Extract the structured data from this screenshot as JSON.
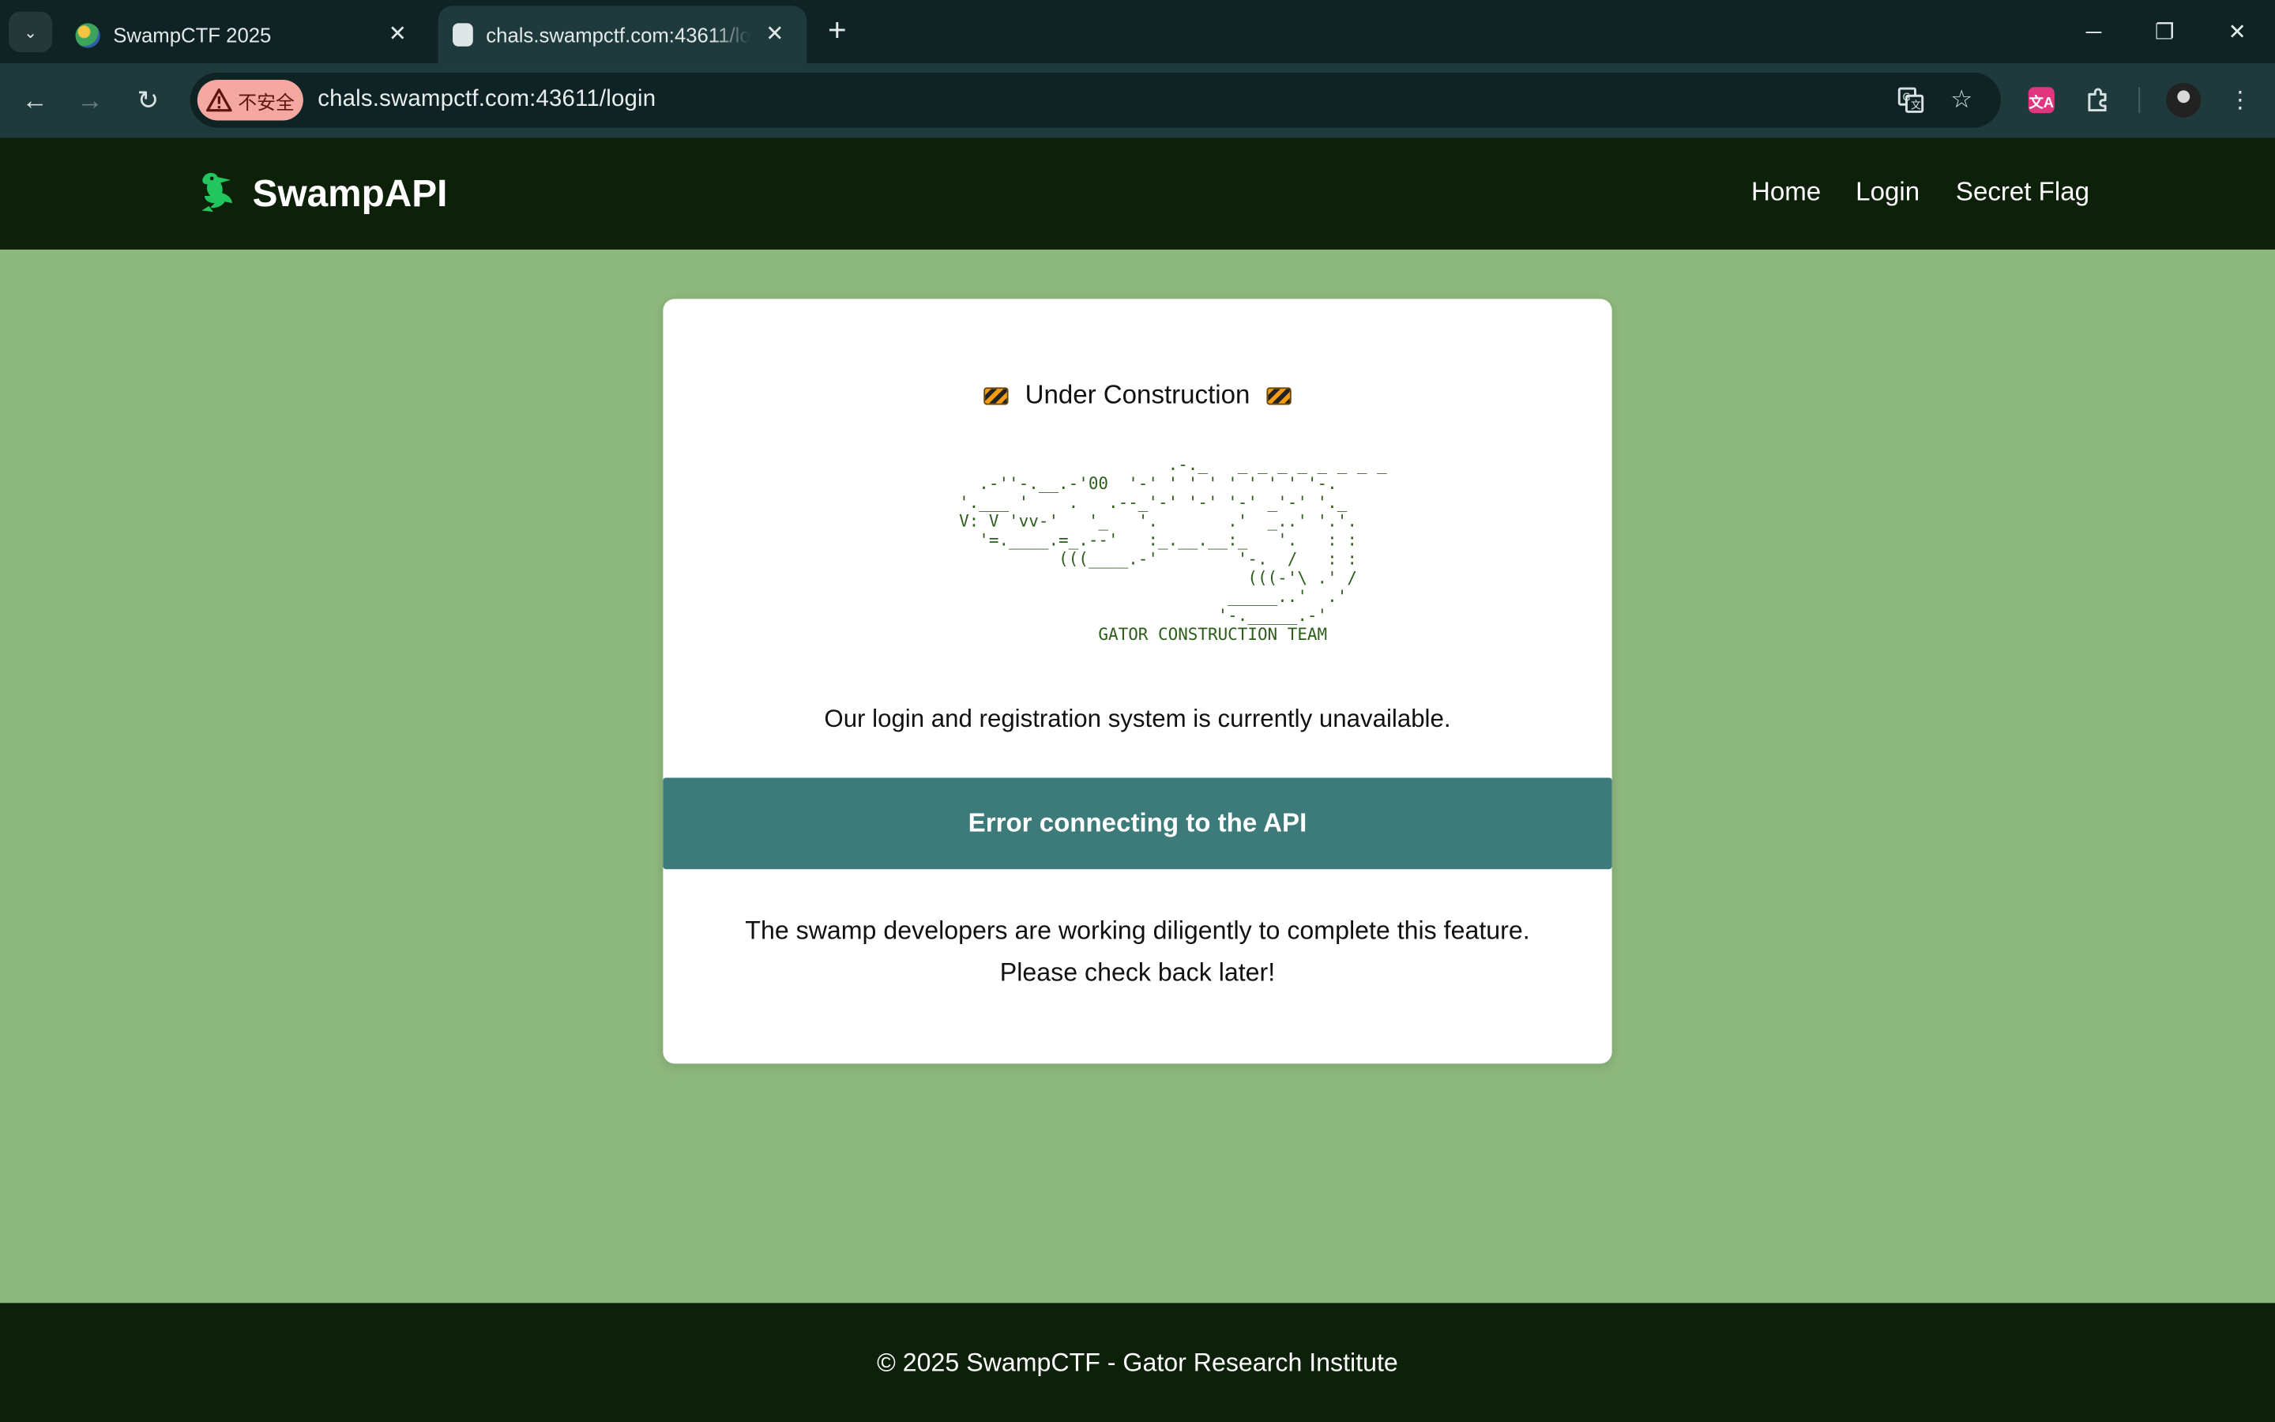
{
  "browser": {
    "tabs": [
      {
        "title": "SwampCTF 2025",
        "active": false
      },
      {
        "title": "chals.swampctf.com:43611/lo",
        "active": true
      }
    ],
    "omnibox": {
      "security_label": "不安全",
      "url": "chals.swampctf.com:43611/login"
    }
  },
  "site": {
    "brand": "SwampAPI",
    "nav": {
      "home": "Home",
      "login": "Login",
      "secret_flag": "Secret Flag"
    }
  },
  "card": {
    "title": "Under Construction",
    "ascii_art": "                     .-._   _ _ _ _ _ _ _ _\n  .-''-.__.-'00  '-' ' ' ' ' ' ' ' '-.\n'.___ '    .   .--_'-' '-' '-' _'-' '._\nV: V 'vv-'   '_   '.       .'  _..' '.'.\n  '=.____.=_.--'   :_.__.__:_   '.   : :\n          (((____.-'        '-.  /   : :\n                             (((-'\\ .' /\n                           _____..'  .'\n                          '-._____.-'\n              GATOR CONSTRUCTION TEAM",
    "status": "Our login and registration system is currently unavailable.",
    "error": "Error connecting to the API",
    "dev_line1": "The swamp developers are working diligently to complete this feature.",
    "dev_line2": "Please check back later!"
  },
  "footer": {
    "text": "© 2025 SwampCTF - Gator Research Institute"
  },
  "colors": {
    "page_bg": "#8db87d",
    "header_bg": "#0d2009",
    "error_banner": "#3d7b7a",
    "ascii_green": "#2d5d1b",
    "logo_green": "#22c55e"
  }
}
